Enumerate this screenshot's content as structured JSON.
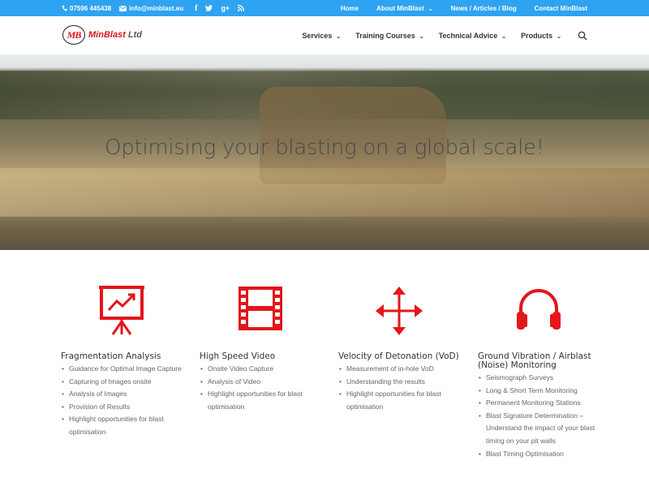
{
  "topbar": {
    "phone": "07596 445438",
    "email": "info@minblast.eu",
    "social_icons": [
      "facebook-icon",
      "twitter-icon",
      "google-plus-icon",
      "rss-icon"
    ],
    "links": [
      "Home",
      "About MinBlast",
      "News / Articles / Blog",
      "Contact MinBlast"
    ],
    "background": "#2ea3f2"
  },
  "header": {
    "logo_badge": "MB",
    "logo_name": "MinBlast",
    "logo_suffix": "Ltd",
    "nav": [
      "Services",
      "Training Courses",
      "Technical Advice",
      "Products"
    ]
  },
  "hero": {
    "headline": "Optimising your blasting on a global scale!"
  },
  "features": [
    {
      "icon": "presentation-chart-icon",
      "title": "Fragmentation Analysis",
      "items": [
        "Guidance for Optimal Image Capture",
        "Capturing of Images onsite",
        "Analysis of Images",
        "Provision of Results",
        "Highlight opportunities for blast optimisation"
      ]
    },
    {
      "icon": "film-strip-icon",
      "title": "High Speed Video",
      "items": [
        "Onsite Video Capture",
        "Analysis of Video",
        "Highlight opportunities for blast optimisation"
      ]
    },
    {
      "icon": "move-arrows-icon",
      "title": "Velocity of Detonation (VoD)",
      "items": [
        "Measurement of in-hole VoD",
        "Understanding the results",
        "Highlight opportunities for blast optimisation"
      ]
    },
    {
      "icon": "headphones-icon",
      "title": "Ground Vibration / Airblast (Noise) Monitoring",
      "items": [
        "Seismograph Surveys",
        "Long & Short Term Monitoring",
        "Permanent Monitoring Stations",
        "Blast Signature Determination – Understand the impact of your blast timing on your pit walls",
        "Blast Timing Optimisation"
      ]
    }
  ],
  "colors": {
    "accent": "#2ea3f2",
    "icon_red": "#e3161b"
  }
}
